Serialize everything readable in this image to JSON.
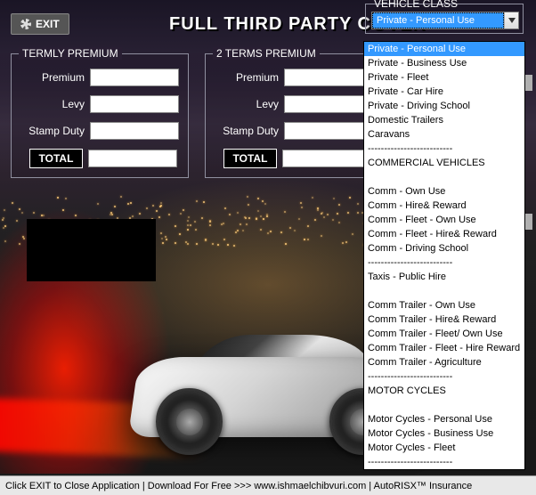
{
  "header": {
    "exit_label": "EXIT",
    "title": "FULL THIRD PARTY COVER"
  },
  "panels": {
    "termly": {
      "legend": "TERMLY PREMIUM",
      "premium_label": "Premium",
      "levy_label": "Levy",
      "stamp_label": "Stamp Duty",
      "total_label": "TOTAL",
      "premium_value": "",
      "levy_value": "",
      "stamp_value": "",
      "total_value": ""
    },
    "two_terms": {
      "legend": "2 TERMS PREMIUM",
      "premium_label": "Premium",
      "levy_label": "Levy",
      "stamp_label": "Stamp Duty",
      "total_label": "TOTAL",
      "premium_value": "",
      "levy_value": "",
      "stamp_value": "",
      "total_value": ""
    }
  },
  "vehicle_class": {
    "legend": "VEHICLE CLASS",
    "selected": "Private - Personal Use",
    "options": [
      "Private - Personal Use",
      "Private - Business Use",
      "Private - Fleet",
      "Private - Car Hire",
      "Private - Driving School",
      "Domestic Trailers",
      "Caravans",
      "--------------------------",
      "COMMERCIAL VEHICLES",
      "",
      "Comm - Own Use",
      "Comm - Hire& Reward",
      "Comm - Fleet - Own Use",
      "Comm - Fleet - Hire& Reward",
      "Comm - Driving School",
      "--------------------------",
      "Taxis - Public Hire",
      "",
      "Comm Trailer - Own Use",
      "Comm Trailer - Hire& Reward",
      "Comm Trailer - Fleet/ Own Use",
      "Comm Trailer - Fleet - Hire Reward",
      "Comm Trailer - Agriculture",
      "--------------------------",
      "MOTOR CYCLES",
      "",
      "Motor Cycles - Personal Use",
      "Motor Cycles - Business Use",
      "Motor Cycles - Fleet",
      "--------------------------"
    ]
  },
  "status": {
    "text": "Click EXIT to Close Application  | Download For Free >>>  www.ishmaelchibvuri.com | AutoRISX™ Insurance"
  }
}
